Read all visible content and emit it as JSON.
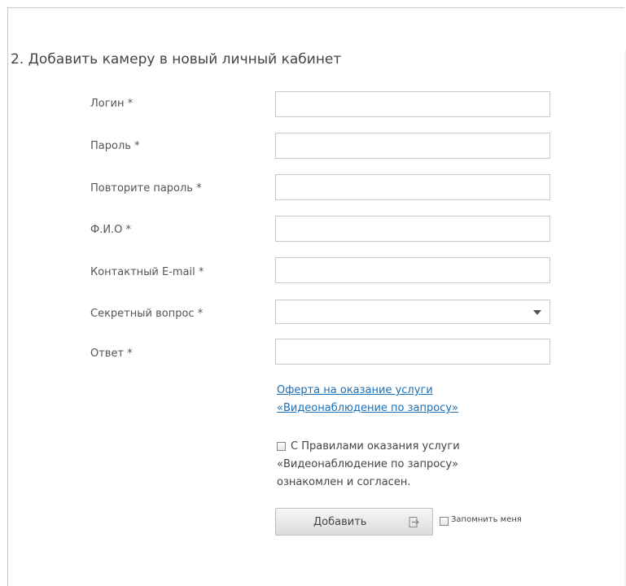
{
  "form": {
    "title": "2. Добавить камеру в новый личный кабинет",
    "fields": [
      {
        "label": "Логин *",
        "value": ""
      },
      {
        "label": "Пароль *",
        "value": ""
      },
      {
        "label": "Повторите пароль *",
        "value": ""
      },
      {
        "label": "Ф.И.О *",
        "value": ""
      },
      {
        "label": "Контактный E-mail *",
        "value": ""
      },
      {
        "label": "Секретный вопрос *",
        "value": ""
      },
      {
        "label": "Ответ *",
        "value": ""
      }
    ],
    "offer_link": {
      "line1": "Оферта на оказание услуги",
      "line2": "«Видеонаблюдение по запросу»"
    },
    "agreement": {
      "line1": "С Правилами оказания услуги",
      "line2": "«Видеонаблюдение по запросу»",
      "line3": "ознакомлен и согласен.",
      "checked": false
    },
    "add_button_label": "Добавить",
    "remember_label": "Запомнить меня",
    "remember_checked": false
  }
}
